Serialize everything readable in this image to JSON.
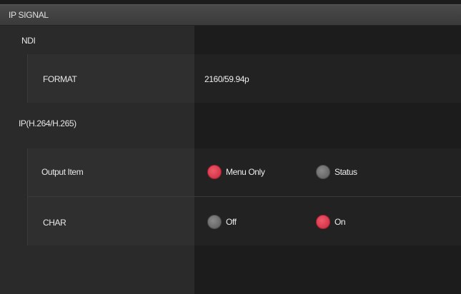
{
  "title": "IP SIGNAL",
  "ndi": {
    "section_label": "NDI",
    "format_label": "FORMAT",
    "format_value": "2160/59.94p"
  },
  "ip_h264_h265": {
    "section_label": "IP(H.264/H.265)",
    "output_item": {
      "label": "Output Item",
      "options": [
        {
          "label": "Menu Only",
          "selected": true
        },
        {
          "label": "Status",
          "selected": false
        }
      ]
    },
    "char": {
      "label": "CHAR",
      "options": [
        {
          "label": "Off",
          "selected": false
        },
        {
          "label": "On",
          "selected": true
        }
      ]
    }
  },
  "colors": {
    "selected_radio": "#d8323f",
    "unselected_radio": "#707070",
    "title_bar": "#424242",
    "label_column": "#2a2a2a",
    "value_column": "#1c1c1c"
  }
}
